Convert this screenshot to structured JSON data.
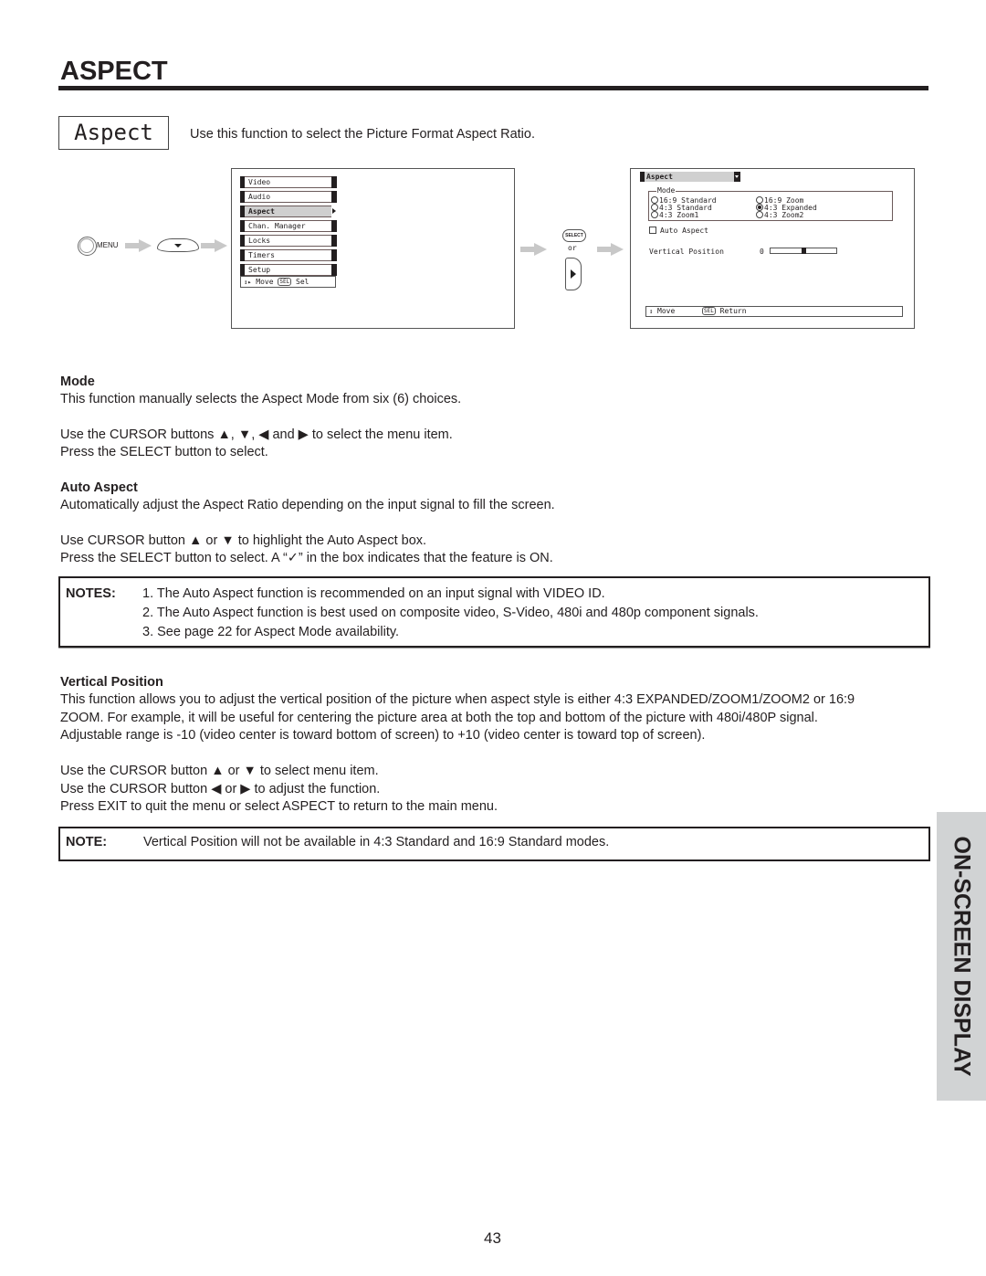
{
  "header": {
    "title": "ASPECT"
  },
  "function_box": {
    "label": "Aspect"
  },
  "intro": "Use this function to select the Picture Format Aspect Ratio.",
  "diagram": {
    "menu_button_label": "MENU",
    "select_button_label": "SELECT",
    "or_label": "or",
    "main_menu": {
      "items": [
        {
          "label": "Video",
          "selected": false
        },
        {
          "label": "Audio",
          "selected": false
        },
        {
          "label": "Aspect",
          "selected": true
        },
        {
          "label": "Chan. Manager",
          "selected": false
        },
        {
          "label": "Locks",
          "selected": false
        },
        {
          "label": "Timers",
          "selected": false
        },
        {
          "label": "Setup",
          "selected": false
        }
      ],
      "hint_move": "Move",
      "hint_sel_badge": "SEL",
      "hint_sel": "Sel"
    },
    "aspect_menu": {
      "header": "Aspect",
      "mode_legend": "Mode",
      "modes": [
        {
          "label": "16:9 Standard",
          "selected": false
        },
        {
          "label": "16:9 Zoom",
          "selected": false
        },
        {
          "label": "4:3 Standard",
          "selected": false
        },
        {
          "label": "4:3 Expanded",
          "selected": true
        },
        {
          "label": "4:3 Zoom1",
          "selected": false
        },
        {
          "label": "4:3 Zoom2",
          "selected": false
        }
      ],
      "auto_aspect_label": "Auto Aspect",
      "auto_aspect_checked": false,
      "vertical_position_label": "Vertical Position",
      "vertical_position_value": "0",
      "vertical_position_range": [
        -10,
        10
      ],
      "hint_move": "Move",
      "hint_sel_badge": "SEL",
      "hint_return": "Return"
    }
  },
  "sections": {
    "mode": {
      "heading": "Mode",
      "lines": [
        "This function manually selects the Aspect Mode from six (6) choices.",
        "Use the CURSOR buttons ▲, ▼, ◀ and ▶ to select the menu item.",
        "Press the SELECT button to select."
      ]
    },
    "auto_aspect": {
      "heading": "Auto Aspect",
      "lines": [
        "Automatically adjust the Aspect Ratio depending on the input signal to fill the screen.",
        "Use CURSOR button ▲ or ▼ to highlight the Auto Aspect box.",
        "Press the SELECT button to select. A “✓” in the box indicates that the feature is ON."
      ]
    },
    "notes": {
      "label": "NOTES:",
      "items": [
        "1. The Auto Aspect function is recommended on an input signal with VIDEO ID.",
        "2. The Auto Aspect function is best used on composite video, S-Video, 480i and 480p component signals.",
        "3. See page 22 for Aspect Mode availability."
      ]
    },
    "vertical_position": {
      "heading": "Vertical Position",
      "paragraph": [
        "This function allows you to adjust the vertical position of the picture when aspect style is either 4:3 EXPANDED/ZOOM1/ZOOM2 or 16:9",
        "ZOOM.  For example, it will be useful for centering the picture area at both the top and bottom of the picture with 480i/480P signal.",
        "Adjustable range is -10 (video center is toward bottom of screen) to +10 (video center is toward top of screen)."
      ],
      "lines": [
        "Use the CURSOR button ▲ or ▼ to select menu item.",
        "Use the CURSOR button ◀ or ▶ to adjust the function.",
        "Press EXIT to quit the menu or select ASPECT to return to the main menu."
      ]
    },
    "note": {
      "label": "NOTE:",
      "text": "Vertical Position will not be available in 4:3 Standard and 16:9 Standard modes."
    }
  },
  "side_tab": "ON-SCREEN DISPLAY",
  "page_number": "43"
}
